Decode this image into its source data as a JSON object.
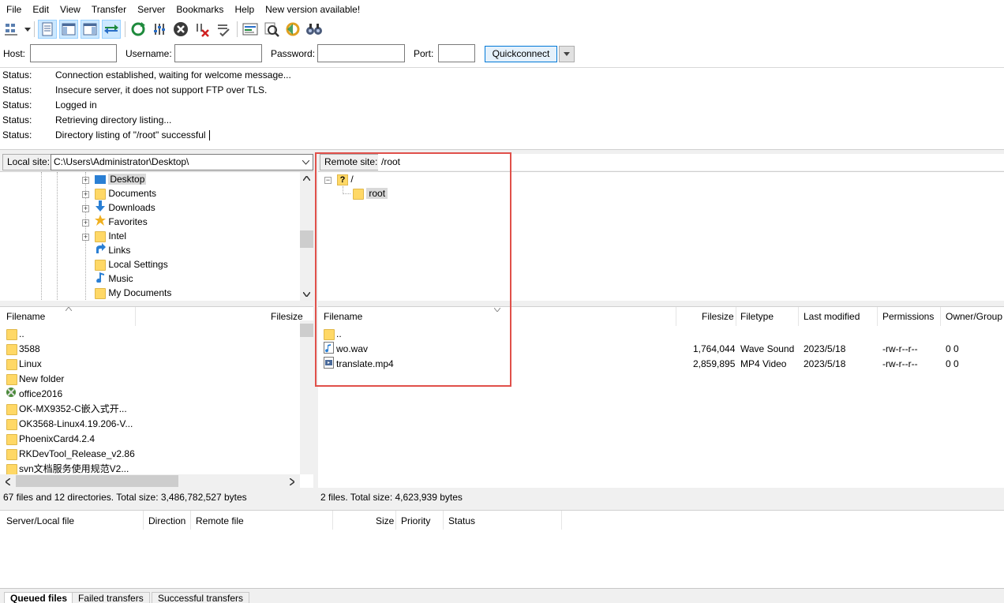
{
  "menu": [
    "File",
    "Edit",
    "View",
    "Transfer",
    "Server",
    "Bookmarks",
    "Help",
    "New version available!"
  ],
  "toolbar_icons": [
    "site-manager-icon",
    "dropdown-arrow-icon",
    "toggle-log-icon",
    "toggle-local-tree-icon",
    "toggle-remote-tree-icon",
    "toggle-queue-icon",
    "refresh-icon",
    "filter-icon",
    "cancel-icon",
    "disconnect-icon",
    "reconnect-icon",
    "compare-icon",
    "search-icon",
    "sync-browse-icon",
    "find-files-icon"
  ],
  "quickconnect": {
    "host_label": "Host:",
    "username_label": "Username:",
    "password_label": "Password:",
    "port_label": "Port:",
    "button": "Quickconnect"
  },
  "log": [
    {
      "type": "Status:",
      "msg": "Connection established, waiting for welcome message..."
    },
    {
      "type": "Status:",
      "msg": "Insecure server, it does not support FTP over TLS."
    },
    {
      "type": "Status:",
      "msg": "Logged in"
    },
    {
      "type": "Status:",
      "msg": "Retrieving directory listing..."
    },
    {
      "type": "Status:",
      "msg": "Directory listing of \"/root\" successful"
    }
  ],
  "local": {
    "site_label": "Local site:",
    "path": "C:\\Users\\Administrator\\Desktop\\",
    "tree": [
      "Desktop",
      "Documents",
      "Downloads",
      "Favorites",
      "Intel",
      "Links",
      "Local Settings",
      "Music",
      "My Documents"
    ],
    "headers": {
      "filename": "Filename",
      "filesize": "Filesize"
    },
    "files": [
      "..",
      "3588",
      "Linux",
      "New folder",
      "office2016",
      "OK-MX9352-C嵌入式开...",
      "OK3568-Linux4.19.206-V...",
      "PhoenixCard4.2.4",
      "RKDevTool_Release_v2.86",
      "svn文档服务使用规范V2..."
    ],
    "status": "67 files and 12 directories. Total size: 3,486,782,527 bytes"
  },
  "remote": {
    "site_label": "Remote site:",
    "path": "/root",
    "tree": [
      "/",
      "root"
    ],
    "headers": {
      "filename": "Filename",
      "filesize": "Filesize",
      "filetype": "Filetype",
      "modified": "Last modified",
      "perms": "Permissions",
      "owner": "Owner/Group"
    },
    "files": [
      {
        "name": "..",
        "size": "",
        "type": "",
        "modified": "",
        "perms": "",
        "owner": ""
      },
      {
        "name": "wo.wav",
        "size": "1,764,044",
        "type": "Wave Sound",
        "modified": "2023/5/18",
        "perms": "-rw-r--r--",
        "owner": "0 0"
      },
      {
        "name": "translate.mp4",
        "size": "2,859,895",
        "type": "MP4 Video",
        "modified": "2023/5/18",
        "perms": "-rw-r--r--",
        "owner": "0 0"
      }
    ],
    "status": "2 files. Total size: 4,623,939 bytes"
  },
  "queue": {
    "headers": {
      "server": "Server/Local file",
      "direction": "Direction",
      "remote": "Remote file",
      "size": "Size",
      "priority": "Priority",
      "status": "Status"
    },
    "tabs": [
      "Queued files",
      "Failed transfers",
      "Successful transfers"
    ]
  }
}
